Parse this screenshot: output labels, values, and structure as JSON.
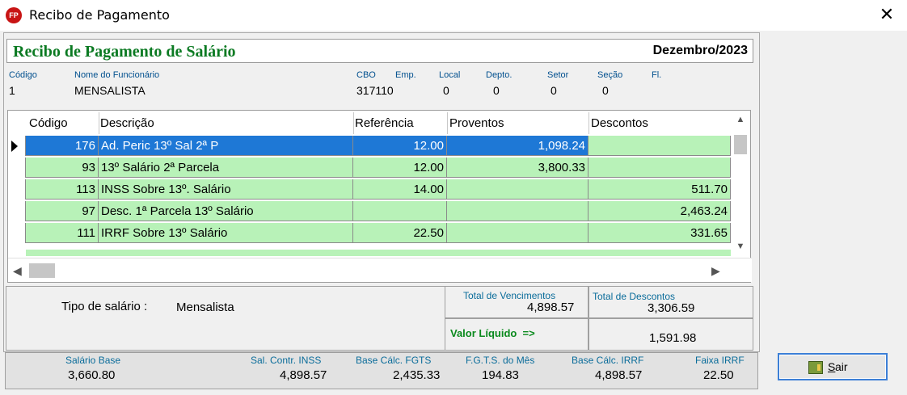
{
  "window": {
    "title": "Recibo de Pagamento",
    "icon_text": "FP"
  },
  "header": {
    "title": "Recibo de Pagamento de Salário",
    "period": "Dezembro/2023"
  },
  "employee": {
    "labels": {
      "code": "Código",
      "name": "Nome do Funcionário",
      "cbo": "CBO",
      "emp": "Emp.",
      "local": "Local",
      "depto": "Depto.",
      "setor": "Setor",
      "secao": "Seção",
      "fl": "Fl."
    },
    "values": {
      "code": "1",
      "name": "MENSALISTA",
      "cbo": "317110",
      "local": "0",
      "depto": "0",
      "setor": "0",
      "secao": "0"
    }
  },
  "grid": {
    "columns": [
      "Código",
      "Descrição",
      "Referência",
      "Proventos",
      "Descontos"
    ],
    "rows": [
      {
        "code": "176",
        "desc": "Ad. Peric 13º Sal 2ª P",
        "ref": "12.00",
        "prov": "1,098.24",
        "desc_val": ""
      },
      {
        "code": "93",
        "desc": "13º Salário 2ª Parcela",
        "ref": "12.00",
        "prov": "3,800.33",
        "desc_val": ""
      },
      {
        "code": "113",
        "desc": "INSS Sobre 13º. Salário",
        "ref": "14.00",
        "prov": "",
        "desc_val": "511.70"
      },
      {
        "code": "97",
        "desc": "Desc. 1ª Parcela 13º Salário",
        "ref": "",
        "prov": "",
        "desc_val": "2,463.24"
      },
      {
        "code": "111",
        "desc": "IRRF Sobre 13º Salário",
        "ref": "22.50",
        "prov": "",
        "desc_val": "331.65"
      }
    ]
  },
  "totals": {
    "salary_type_label": "Tipo de salário :",
    "salary_type": "Mensalista",
    "total_vencimentos_label": "Total de Vencimentos",
    "total_vencimentos": "4,898.57",
    "total_descontos_label": "Total de Descontos",
    "total_descontos": "3,306.59",
    "valor_liquido_label": "Valor Líquido  =>",
    "valor_liquido": "1,591.98"
  },
  "summary": {
    "salario_base_label": "Salário Base",
    "salario_base": "3,660.80",
    "sal_contr_inss_label": "Sal. Contr. INSS",
    "sal_contr_inss": "4,898.57",
    "base_fgts_label": "Base Cálc. FGTS",
    "base_fgts": "2,435.33",
    "fgts_mes_label": "F.G.T.S. do Mês",
    "fgts_mes": "194.83",
    "base_irrf_label": "Base Cálc. IRRF",
    "base_irrf": "4,898.57",
    "faixa_irrf_label": "Faixa IRRF",
    "faixa_irrf": "22.50"
  },
  "buttons": {
    "sair_first": "S",
    "sair_rest": "air"
  },
  "colors": {
    "title_green": "#0b7a22",
    "row_green": "#b8f2b8",
    "selection_blue": "#1e78d6",
    "label_blue": "#0a6c9a"
  }
}
